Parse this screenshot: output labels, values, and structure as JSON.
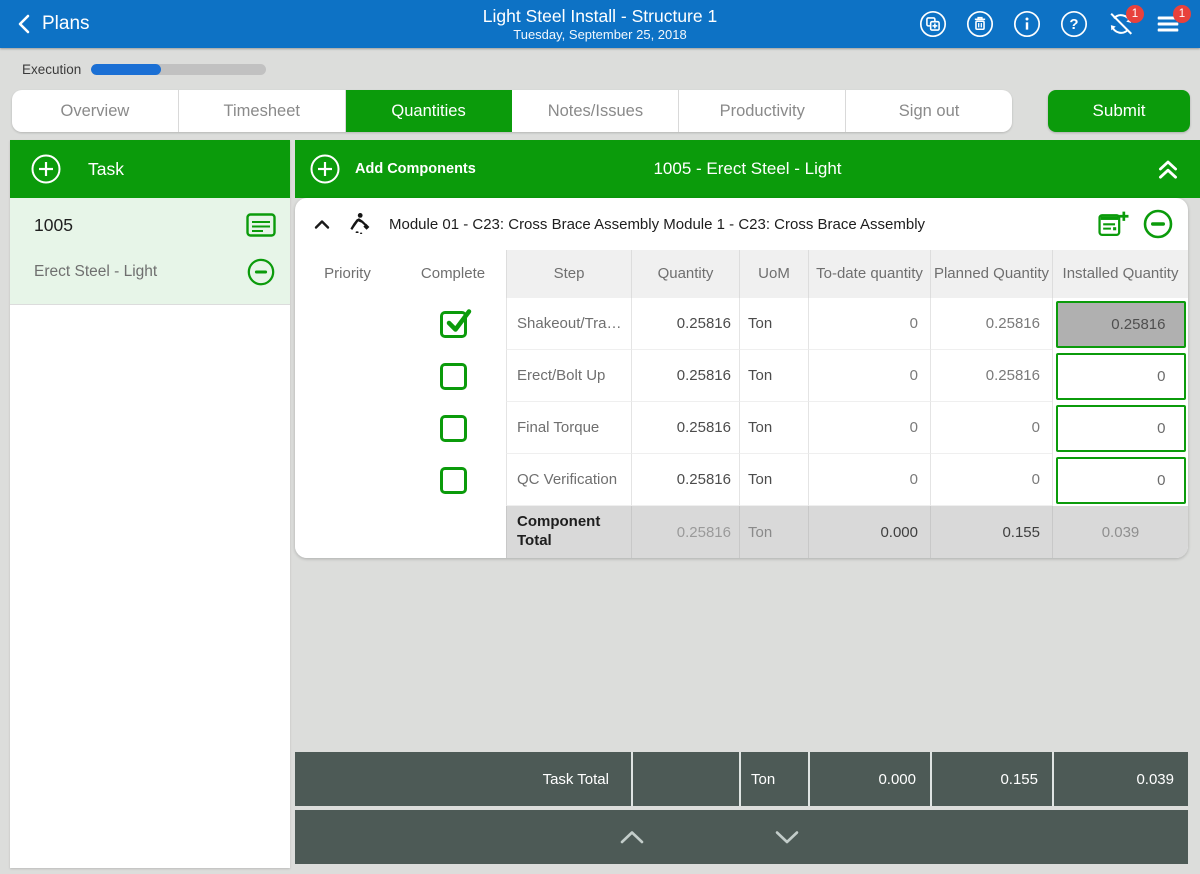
{
  "topbar": {
    "back_label": "Plans",
    "title": "Light Steel Install - Structure 1",
    "date": "Tuesday, September 25, 2018",
    "action_icons": [
      "duplicate-icon",
      "trash-icon",
      "info-icon",
      "help-icon",
      "sync-off-icon",
      "menu-icon"
    ],
    "badges": {
      "sync": "1",
      "menu": "1"
    }
  },
  "progress": {
    "label": "Execution",
    "percent": 40
  },
  "tabs": {
    "items": [
      {
        "label": "Overview",
        "active": false
      },
      {
        "label": "Timesheet",
        "active": false
      },
      {
        "label": "Quantities",
        "active": true
      },
      {
        "label": "Notes/Issues",
        "active": false
      },
      {
        "label": "Productivity",
        "active": false
      },
      {
        "label": "Sign out",
        "active": false
      }
    ],
    "submit_label": "Submit"
  },
  "task_panel": {
    "header_label": "Task",
    "tasks": [
      {
        "code": "1005",
        "name": "Erect Steel - Light",
        "selected": true
      }
    ]
  },
  "component_panel": {
    "header": {
      "add_label": "Add Components",
      "title": "1005 - Erect Steel - Light"
    },
    "component": {
      "title": "Module 01 - C23: Cross Brace Assembly Module 1 - C23: Cross Brace Assembly",
      "columns": {
        "priority": "Priority",
        "complete": "Complete",
        "step": "Step",
        "quantity": "Quantity",
        "uom": "UoM",
        "to_date": "To-date quantity",
        "planned": "Planned Quantity",
        "installed": "Installed Quantity"
      },
      "steps": [
        {
          "complete": true,
          "step": "Shakeout/Tra…",
          "quantity": "0.25816",
          "uom": "Ton",
          "to_date": "0",
          "planned": "0.25816",
          "installed": "0.25816"
        },
        {
          "complete": false,
          "step": "Erect/Bolt Up",
          "quantity": "0.25816",
          "uom": "Ton",
          "to_date": "0",
          "planned": "0.25816",
          "installed": "0"
        },
        {
          "complete": false,
          "step": "Final Torque",
          "quantity": "0.25816",
          "uom": "Ton",
          "to_date": "0",
          "planned": "0",
          "installed": "0"
        },
        {
          "complete": false,
          "step": "QC Verification",
          "quantity": "0.25816",
          "uom": "Ton",
          "to_date": "0",
          "planned": "0",
          "installed": "0"
        }
      ],
      "total": {
        "label": "Component Total",
        "quantity": "0.25816",
        "uom": "Ton",
        "to_date": "0.000",
        "planned": "0.155",
        "installed": "0.039"
      }
    },
    "task_total": {
      "label": "Task Total",
      "quantity": "",
      "uom": "Ton",
      "to_date": "0.000",
      "planned": "0.155",
      "installed": "0.039"
    }
  },
  "colors": {
    "topbar_blue": "#0d72c5",
    "progress_blue": "#1a6fd4",
    "accent_green": "#0b9b0b",
    "selected_task_bg": "#e7f5e8",
    "dark_bar": "#4d5a56",
    "badge_red": "#e8413c"
  }
}
